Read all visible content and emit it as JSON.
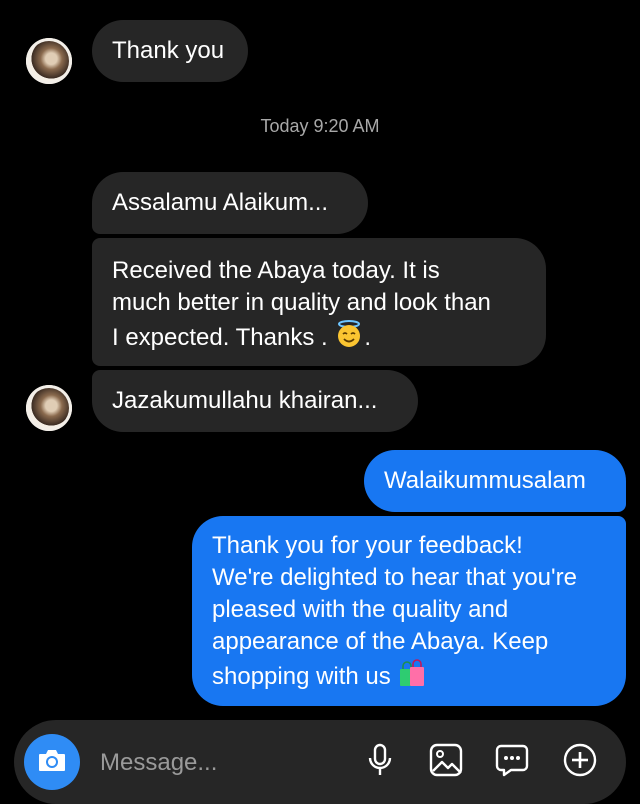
{
  "messages": [
    {
      "sender": "them",
      "text": "Thank you"
    },
    {
      "type": "timestamp",
      "text": "Today 9:20 AM"
    },
    {
      "sender": "them",
      "text": "Assalamu Alaikum..."
    },
    {
      "sender": "them",
      "lines": [
        "Received the Abaya today. It is",
        "much better in quality and look than",
        "I expected. Thanks ."
      ],
      "emoji": "smiling-face-with-halo"
    },
    {
      "sender": "them",
      "text": "Jazakumullahu khairan..."
    },
    {
      "sender": "me",
      "text": "Walaikummusalam"
    },
    {
      "sender": "me",
      "lines": [
        "Thank you for your feedback!",
        "We're delighted to hear that you're",
        "pleased with the quality and",
        "appearance of the Abaya. Keep",
        "shopping with us"
      ],
      "emoji": "shopping-bags"
    }
  ],
  "composer": {
    "placeholder": "Message...",
    "icons": [
      "camera-icon",
      "microphone-icon",
      "gallery-icon",
      "sticker-icon",
      "plus-icon"
    ]
  },
  "colors": {
    "background": "#000000",
    "incoming_bubble": "#262626",
    "outgoing_bubble": "#1877f2",
    "camera_button": "#2f8cf5",
    "timestamp_text": "#a8a8a8"
  }
}
